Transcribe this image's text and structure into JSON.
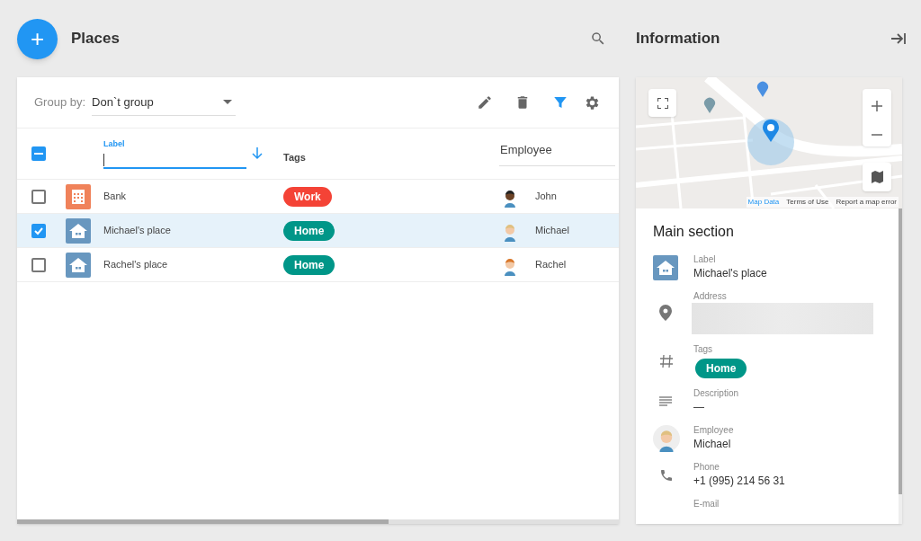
{
  "header": {
    "add_button": "+",
    "title": "Places",
    "info_title": "Information"
  },
  "toolbar": {
    "group_by_label": "Group by:",
    "group_by_value": "Don`t group",
    "filter_active": true
  },
  "table": {
    "select_all_partial": true,
    "columns": [
      {
        "kind": "label",
        "label": "Label",
        "sort_descending": true
      },
      {
        "kind": "text",
        "label": "Tags"
      },
      {
        "kind": "employee",
        "label": "Employee"
      }
    ],
    "rows": [
      {
        "kind": "office",
        "label": "Bank",
        "tag": {
          "text": "Work",
          "color": "#f44336"
        },
        "employee": "John",
        "selected": false
      },
      {
        "kind": "home",
        "label": "Michael's place",
        "tag": {
          "text": "Home",
          "color": "#009688"
        },
        "employee": "Michael",
        "selected": true
      },
      {
        "kind": "home",
        "label": "Rachel's place",
        "tag": {
          "text": "Home",
          "color": "#009688"
        },
        "employee": "Rachel",
        "selected": false
      }
    ]
  },
  "map": {
    "links": [
      "Map Data",
      "Terms of Use",
      "Report a map error"
    ]
  },
  "details": {
    "title": "Main section",
    "fields": [
      {
        "kind": "place",
        "label": "Label",
        "value": "Michael's place"
      },
      {
        "kind": "address",
        "label": "Address"
      },
      {
        "kind": "tags",
        "label": "Tags",
        "tags": [
          {
            "text": "Home",
            "color": "#009688"
          }
        ]
      },
      {
        "kind": "description",
        "label": "Description",
        "value": "—"
      },
      {
        "kind": "employee",
        "label": "Employee",
        "value": "Michael"
      },
      {
        "kind": "phone",
        "label": "Phone",
        "value": "+1 (995) 214 56 31"
      },
      {
        "kind": "email",
        "label": "E-mail"
      }
    ]
  }
}
